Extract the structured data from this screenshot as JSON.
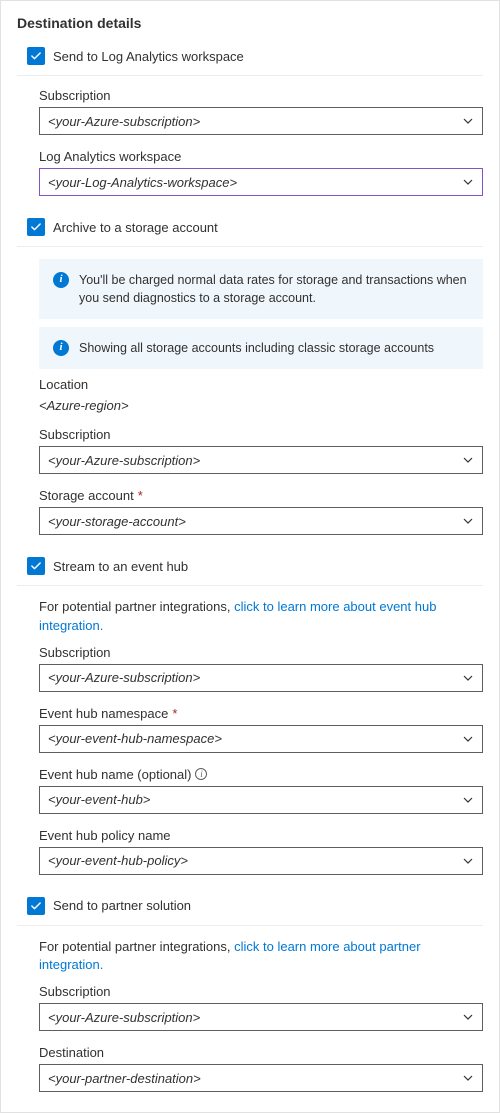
{
  "title": "Destination details",
  "sections": {
    "logAnalytics": {
      "checkboxLabel": "Send to Log Analytics workspace",
      "fields": {
        "subscription": {
          "label": "Subscription",
          "value": "<your-Azure-subscription>"
        },
        "workspace": {
          "label": "Log Analytics workspace",
          "value": "<your-Log-Analytics-workspace>"
        }
      }
    },
    "storage": {
      "checkboxLabel": "Archive to a storage account",
      "info1": "You'll be charged normal data rates for storage and transactions when you send diagnostics to a storage account.",
      "info2": "Showing all storage accounts including classic storage accounts",
      "fields": {
        "location": {
          "label": "Location",
          "value": "<Azure-region>"
        },
        "subscription": {
          "label": "Subscription",
          "value": "<your-Azure-subscription>"
        },
        "storageAccount": {
          "label": "Storage account",
          "value": "<your-storage-account>"
        }
      }
    },
    "eventHub": {
      "checkboxLabel": "Stream to an event hub",
      "helperPrefix": "For potential partner integrations, ",
      "helperLink": "click to learn more about event hub integration.",
      "fields": {
        "subscription": {
          "label": "Subscription",
          "value": "<your-Azure-subscription>"
        },
        "namespace": {
          "label": "Event hub namespace",
          "value": "<your-event-hub-namespace>"
        },
        "name": {
          "label": "Event hub name (optional)",
          "value": "<your-event-hub>"
        },
        "policy": {
          "label": "Event hub policy name",
          "value": "<your-event-hub-policy>"
        }
      }
    },
    "partner": {
      "checkboxLabel": "Send to partner solution",
      "helperPrefix": "For potential partner integrations, ",
      "helperLink": "click to learn more about partner integration.",
      "fields": {
        "subscription": {
          "label": "Subscription",
          "value": "<your-Azure-subscription>"
        },
        "destination": {
          "label": "Destination",
          "value": "<your-partner-destination>"
        }
      }
    }
  },
  "glyphs": {
    "info": "i",
    "required": "*"
  }
}
